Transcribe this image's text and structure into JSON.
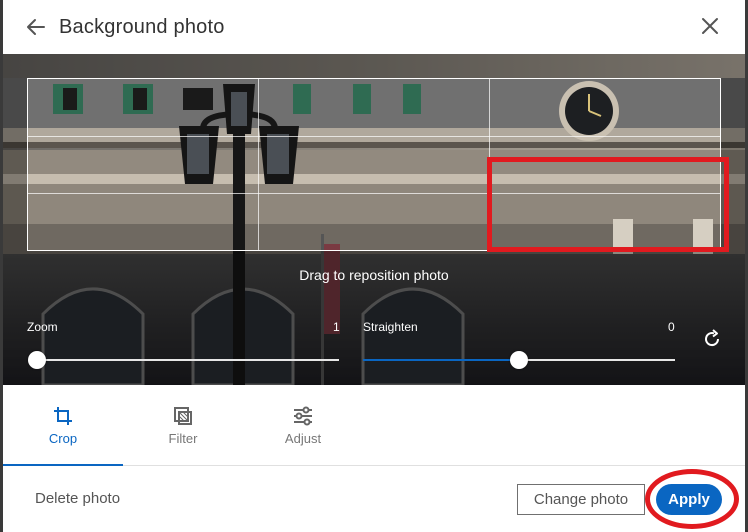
{
  "header": {
    "title": "Background photo"
  },
  "stage": {
    "hint": "Drag to reposition photo"
  },
  "zoom": {
    "label": "Zoom",
    "value": "1",
    "level": 0.0
  },
  "straighten": {
    "label": "Straighten",
    "value": "0",
    "level": 0.5
  },
  "tabs": [
    {
      "label": "Crop",
      "icon": "crop-icon",
      "active": true
    },
    {
      "label": "Filter",
      "icon": "filter-icon",
      "active": false
    },
    {
      "label": "Adjust",
      "icon": "adjust-icon",
      "active": false
    }
  ],
  "footer": {
    "delete_label": "Delete photo",
    "change_label": "Change photo",
    "apply_label": "Apply"
  },
  "colors": {
    "accent": "#0a66c2",
    "annotation": "#e11a1f"
  }
}
